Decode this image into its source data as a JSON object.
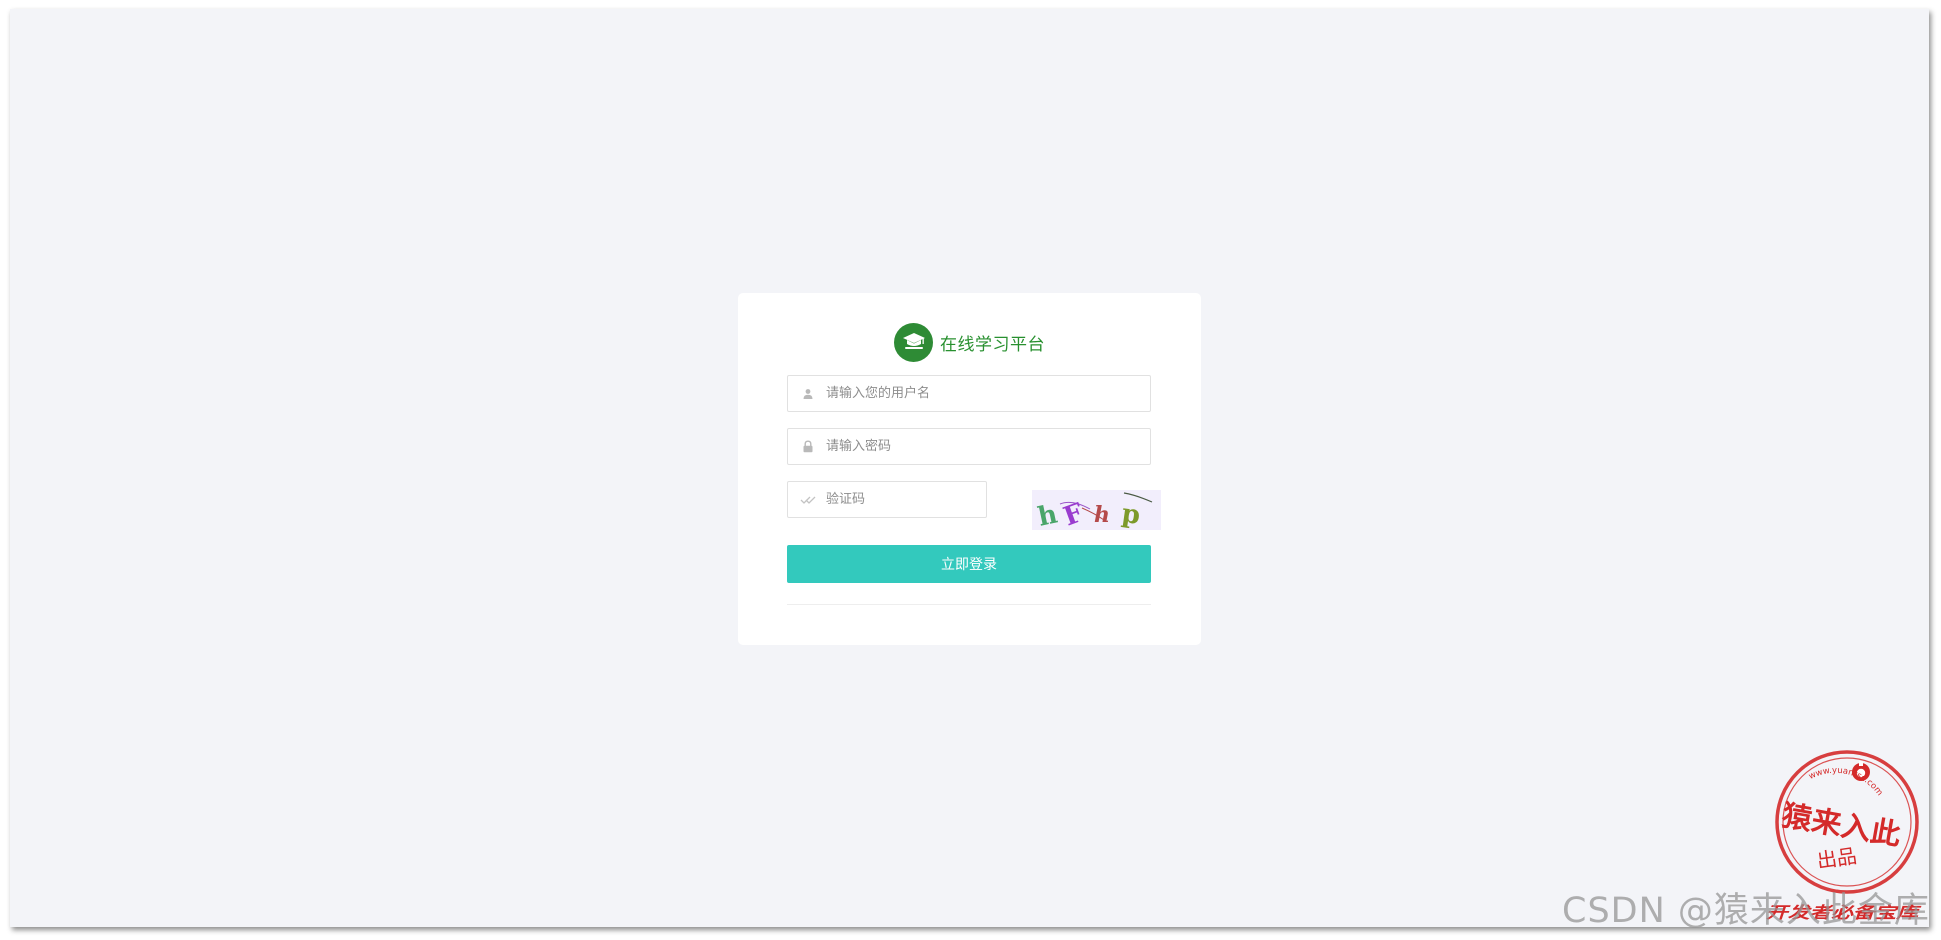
{
  "brand": {
    "title": "在线学习平台",
    "logo_icon": "graduation-cap-icon",
    "logo_color": "#2e8b35"
  },
  "form": {
    "username": {
      "placeholder": "请输入您的用户名",
      "value": "",
      "icon": "user-icon"
    },
    "password": {
      "placeholder": "请输入密码",
      "value": "",
      "icon": "lock-icon"
    },
    "captcha": {
      "placeholder": "验证码",
      "value": "",
      "icon": "check-icon",
      "image_text": "hFhp"
    },
    "submit_label": "立即登录"
  },
  "colors": {
    "page_background": "#f3f4f8",
    "button": "#33c9bd",
    "brand_text": "#28902f",
    "stamp": "#d42a2a"
  },
  "stamp": {
    "url_text": "www.yuanrsc.com",
    "main_text": "猿来入此",
    "sub_text": "出品",
    "bottom_text": "开发者必备宝库"
  },
  "watermark": "CSDN @猿来入此金库"
}
